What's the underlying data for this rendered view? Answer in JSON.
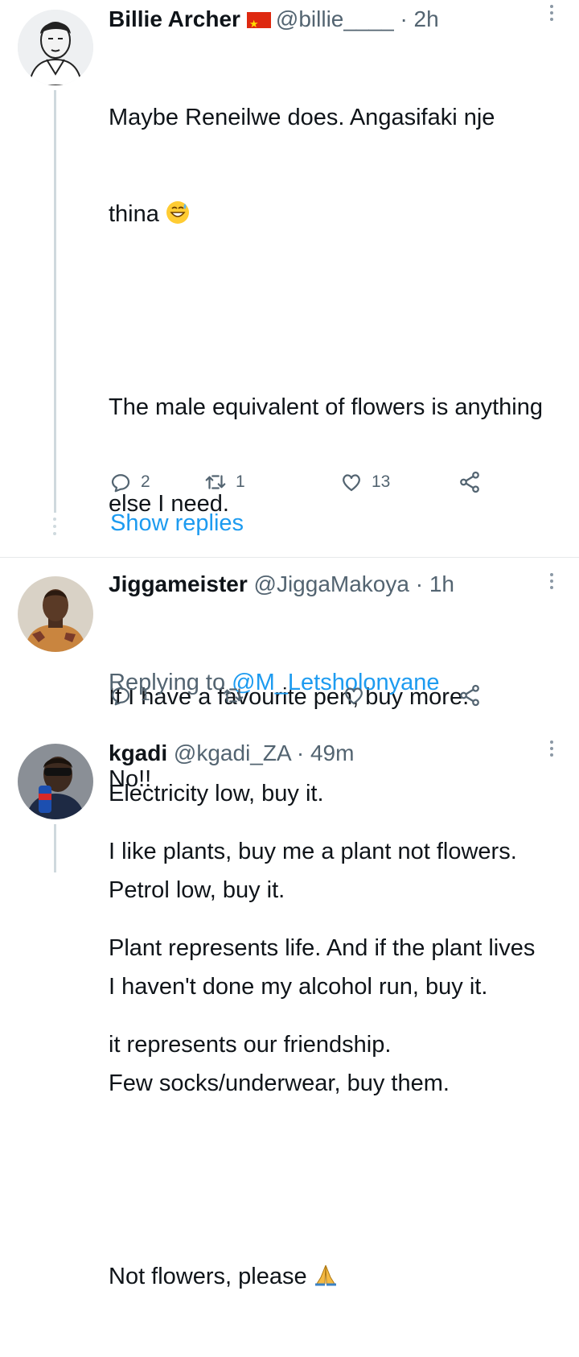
{
  "tweets": [
    {
      "name": "Billie Archer",
      "handle": "@billie____",
      "time": "· 2h",
      "body_lines": [
        "Maybe Reneilwe does. Angasifaki nje",
        "thina",
        "",
        "The male equivalent of flowers is anything",
        "else I need.",
        "",
        "If I have a favourite pen, buy more.",
        "Electricity low, buy it.",
        "Petrol low, buy it.",
        "I haven't done my alcohol run, buy it.",
        "Few socks/underwear, buy them.",
        "",
        "Not flowers, please"
      ],
      "counts": {
        "replies": "2",
        "retweets": "1",
        "likes": "13"
      },
      "show_replies": "Show replies"
    },
    {
      "name": "Jiggameister",
      "handle": "@JiggaMakoya",
      "time": "· 1h",
      "replying_prefix": "Replying to",
      "replying_mention": "@M_Letsholonyane",
      "body_lines": [
        "No!!"
      ],
      "counts": {
        "replies": "1",
        "retweets": "",
        "likes": ""
      }
    },
    {
      "name": "kgadi",
      "handle": "@kgadi_ZA",
      "time": "· 49m",
      "body_lines": [
        "I like plants, buy me a plant not flowers.",
        "Plant represents life. And if the plant lives",
        "it represents our friendship."
      ]
    }
  ],
  "colors": {
    "link": "#1d9bf0",
    "muted": "#536471",
    "text": "#0f1419",
    "line": "#cfd9de"
  },
  "icons": [
    "reply-icon",
    "retweet-icon",
    "like-icon",
    "share-icon",
    "more-icon",
    "grinning-sweat-emoji",
    "folded-hands-emoji",
    "china-flag-icon"
  ]
}
